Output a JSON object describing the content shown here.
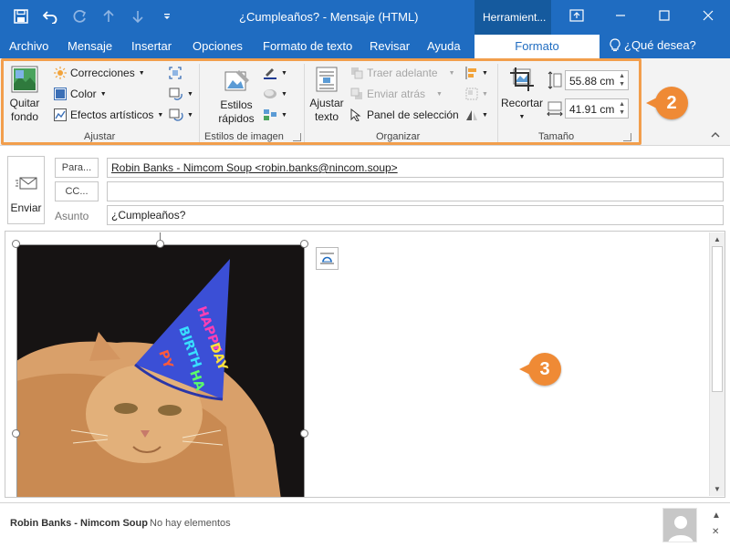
{
  "window": {
    "title": "¿Cumpleaños?  -  Mensaje (HTML)",
    "tools_tab": "Herramient...",
    "quick_access": [
      "save-icon",
      "undo-icon",
      "redo-icon",
      "up-arrow-icon",
      "down-arrow-icon",
      "customize-icon"
    ],
    "controls": [
      "restore-ribbon-icon",
      "minimize-icon",
      "maximize-icon",
      "close-icon"
    ]
  },
  "tabs": [
    {
      "label": "Archivo"
    },
    {
      "label": "Mensaje"
    },
    {
      "label": "Insertar"
    },
    {
      "label": "Opciones"
    },
    {
      "label": "Formato de texto"
    },
    {
      "label": "Revisar"
    },
    {
      "label": "Ayuda"
    },
    {
      "label": "Formato",
      "active": true
    }
  ],
  "tell_me": "¿Qué desea?",
  "ribbon": {
    "ajustar": {
      "label": "Ajustar",
      "quitar_fondo": [
        "Quitar",
        "fondo"
      ],
      "correcciones": "Correcciones",
      "color": "Color",
      "efectos": "Efectos artísticos"
    },
    "estilos": {
      "label": "Estilos de imagen",
      "estilos_rapidos": [
        "Estilos",
        "rápidos"
      ]
    },
    "organizar": {
      "label": "Organizar",
      "ajustar_texto": [
        "Ajustar",
        "texto"
      ],
      "traer_adelante": "Traer adelante",
      "enviar_atras": "Enviar atrás",
      "panel_seleccion": "Panel de selección"
    },
    "tamano": {
      "label": "Tamaño",
      "recortar": "Recortar",
      "height": "55.88 cm",
      "width": "41.91 cm"
    }
  },
  "callouts": {
    "ribbon": "2",
    "body": "3"
  },
  "colors": {
    "accent": "#1f6cc1",
    "callout": "#ef8a35",
    "hat_blue": "#3b4fd6",
    "cat": "#d9a06a"
  },
  "message": {
    "send_label": "Enviar",
    "to_button": "Para...",
    "cc_button": "CC...",
    "subject_label": "Asunto",
    "to_value": "Robin Banks - Nimcom Soup <robin.banks@nincom.soup>",
    "cc_value": "",
    "subject_value": "¿Cumpleaños?"
  },
  "status": {
    "contact": "Robin Banks - Nimcom Soup",
    "items": "No hay elementos"
  }
}
